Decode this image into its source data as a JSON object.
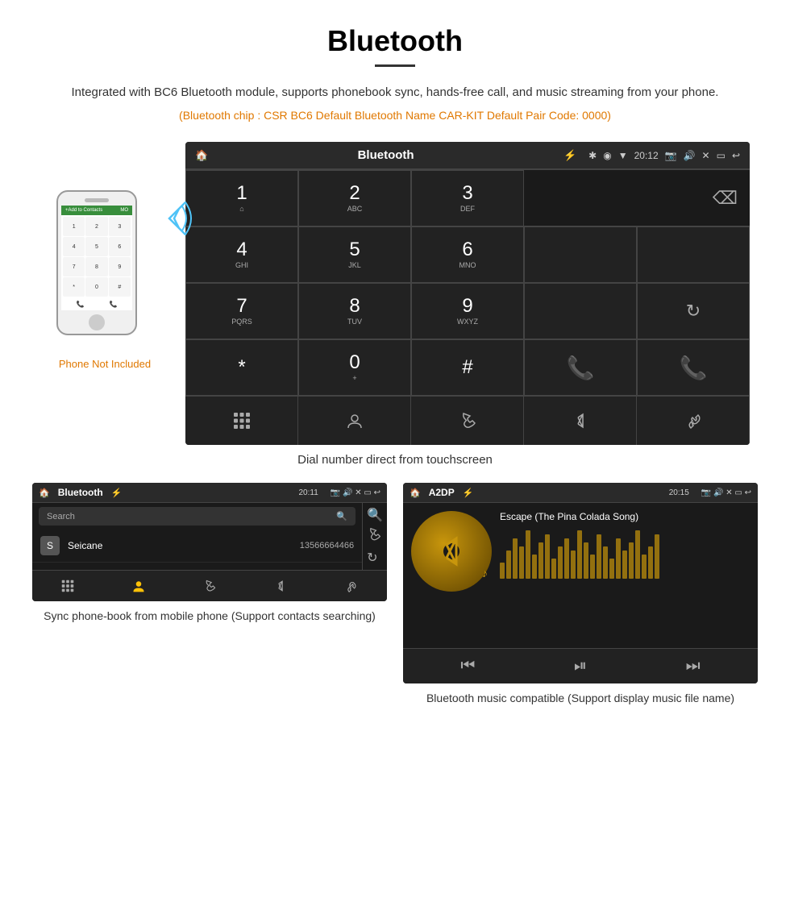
{
  "page": {
    "title": "Bluetooth",
    "description": "Integrated with BC6 Bluetooth module, supports phonebook sync, hands-free call, and music streaming from your phone.",
    "specs": "(Bluetooth chip : CSR BC6    Default Bluetooth Name CAR-KIT    Default Pair Code: 0000)",
    "dial_caption": "Dial number direct from touchscreen",
    "phonebook_caption": "Sync phone-book from mobile phone\n(Support contacts searching)",
    "music_caption": "Bluetooth music compatible\n(Support display music file name)"
  },
  "phone_label": "Phone Not Included",
  "car_screen": {
    "header_title": "Bluetooth",
    "time": "20:12",
    "keys": [
      {
        "num": "1",
        "sub": "⌂"
      },
      {
        "num": "2",
        "sub": "ABC"
      },
      {
        "num": "3",
        "sub": "DEF"
      },
      {
        "num": "4",
        "sub": "GHI"
      },
      {
        "num": "5",
        "sub": "JKL"
      },
      {
        "num": "6",
        "sub": "MNO"
      },
      {
        "num": "7",
        "sub": "PQRS"
      },
      {
        "num": "8",
        "sub": "TUV"
      },
      {
        "num": "9",
        "sub": "WXYZ"
      },
      {
        "num": "*",
        "sub": ""
      },
      {
        "num": "0",
        "sub": "+"
      },
      {
        "num": "#",
        "sub": ""
      }
    ]
  },
  "phonebook_screen": {
    "title": "Bluetooth",
    "time": "20:11",
    "search_placeholder": "Search",
    "contacts": [
      {
        "initial": "S",
        "name": "Seicane",
        "number": "13566664466"
      }
    ]
  },
  "music_screen": {
    "title": "A2DP",
    "time": "20:15",
    "song": "Escape (The Pina Colada Song)",
    "bar_heights": [
      20,
      35,
      50,
      40,
      60,
      30,
      45,
      55,
      25,
      40,
      50,
      35,
      60,
      45,
      30,
      55,
      40,
      25,
      50,
      35,
      45,
      60,
      30,
      40,
      55
    ]
  }
}
